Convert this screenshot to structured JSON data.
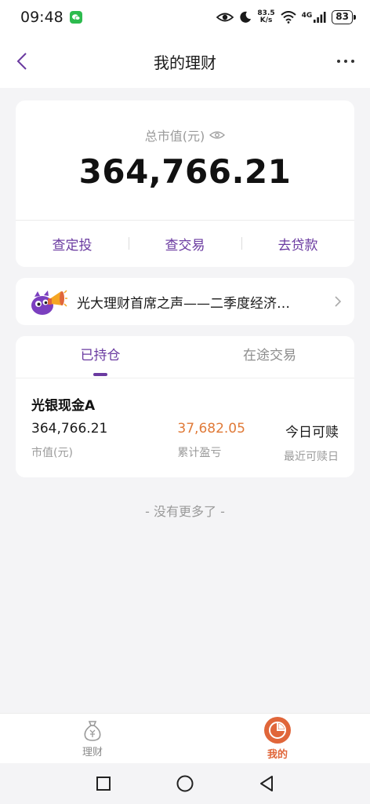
{
  "status_bar": {
    "time": "09:48",
    "net_speed_value": "83.5",
    "net_speed_unit": "K/s",
    "network_type": "4G",
    "battery": "83"
  },
  "header": {
    "title": "我的理财"
  },
  "summary": {
    "total_label": "总市值(元)",
    "total_value": "364,766.21",
    "actions": [
      "查定投",
      "查交易",
      "去贷款"
    ]
  },
  "notice": {
    "text": "光大理财首席之声——二季度经济…"
  },
  "holdings": {
    "tabs": [
      {
        "label": "已持仓",
        "active": true
      },
      {
        "label": "在途交易",
        "active": false
      }
    ],
    "product": {
      "name": "光银现金A",
      "market_value": "364,766.21",
      "market_value_label": "市值(元)",
      "cumulative_pnl": "37,682.05",
      "cumulative_pnl_label": "累计盈亏",
      "redeem_date": "今日可赎",
      "redeem_date_label": "最近可赎日"
    }
  },
  "end_note": "- 没有更多了 -",
  "bottom_nav": [
    {
      "label": "理财",
      "icon": "money-bag-icon",
      "active": false
    },
    {
      "label": "我的",
      "icon": "pie-chart-icon",
      "active": true
    }
  ],
  "colors": {
    "accent": "#6a3aa0",
    "profit": "#e07a38",
    "active_nav": "#e0663a"
  }
}
